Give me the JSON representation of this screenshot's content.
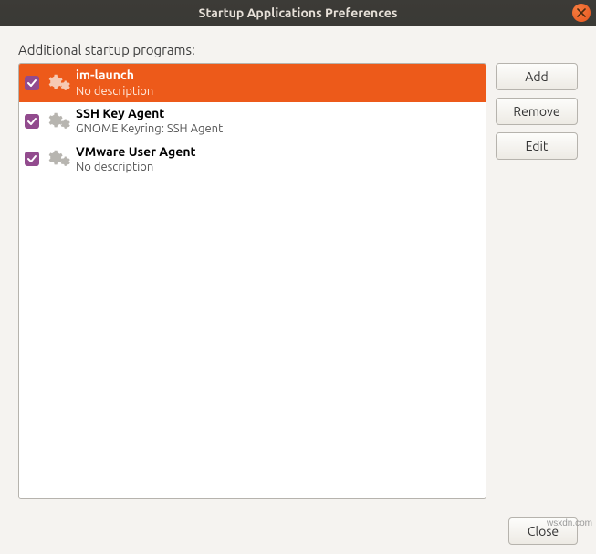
{
  "titlebar": {
    "title": "Startup Applications Preferences"
  },
  "label": "Additional startup programs:",
  "programs": [
    {
      "name": "im-launch",
      "desc": "No description",
      "checked": true,
      "selected": true
    },
    {
      "name": "SSH Key Agent",
      "desc": "GNOME Keyring: SSH Agent",
      "checked": true,
      "selected": false
    },
    {
      "name": "VMware User Agent",
      "desc": "No description",
      "checked": true,
      "selected": false
    }
  ],
  "buttons": {
    "add": "Add",
    "remove": "Remove",
    "edit": "Edit",
    "close": "Close"
  },
  "watermark": "wsxdn.com",
  "colors": {
    "accent": "#ed5a1a",
    "checkbox": "#924b8e",
    "close": "#e8561e"
  }
}
